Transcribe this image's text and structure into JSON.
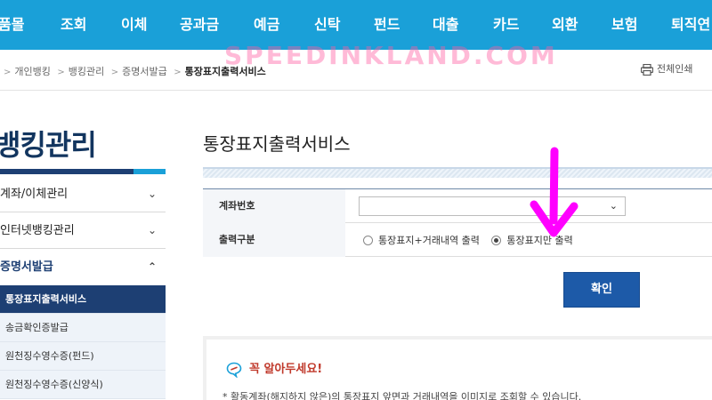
{
  "topnav": {
    "items": [
      "품몰",
      "조회",
      "이체",
      "공과금",
      "예금",
      "신탁",
      "펀드",
      "대출",
      "카드",
      "외환",
      "보험",
      "퇴직연"
    ]
  },
  "watermark": "SPEEDINKLAND.COM",
  "breadcrumb": {
    "items": [
      "개인뱅킹",
      "뱅킹관리",
      "증명서발급"
    ],
    "current": "통장표지출력서비스",
    "separator": ">"
  },
  "print_all_label": "전체인쇄",
  "sidebar": {
    "title": "뱅킹관리",
    "items": [
      {
        "label": "계좌/이체관리"
      },
      {
        "label": "인터넷뱅킹관리"
      },
      {
        "label": "증명서발급"
      }
    ],
    "subitems": [
      {
        "label": "통장표지출력서비스",
        "active": true
      },
      {
        "label": "송금확인증발급",
        "active": false
      },
      {
        "label": "원천징수영수증(펀드)",
        "active": false
      },
      {
        "label": "원천징수영수증(신양식)",
        "active": false
      }
    ]
  },
  "main": {
    "title": "통장표지출력서비스",
    "form": {
      "account_label": "계좌번호",
      "account_value": "",
      "output_label": "출력구분",
      "options": [
        {
          "label": "통장표지+거래내역 출력",
          "checked": false
        },
        {
          "label": "통장표지만 출력",
          "checked": true
        }
      ]
    },
    "confirm_label": "확인"
  },
  "notice": {
    "heading": "꼭 알아두세요!",
    "text": "* 활동계좌(해지하지 않은)의 통장표지 앞면과 거래내역을 이미지로 조회할 수 있습니다."
  },
  "colors": {
    "nav": "#1aa0d8",
    "navy": "#1d3f73",
    "button": "#1d5aa8",
    "arrow": "#ff00ff",
    "notice_heading": "#c0392b"
  },
  "icons": [
    "printer-icon",
    "chevron-down-icon",
    "chevron-up-icon",
    "speech-bubble-icon",
    "annotation-arrow"
  ]
}
